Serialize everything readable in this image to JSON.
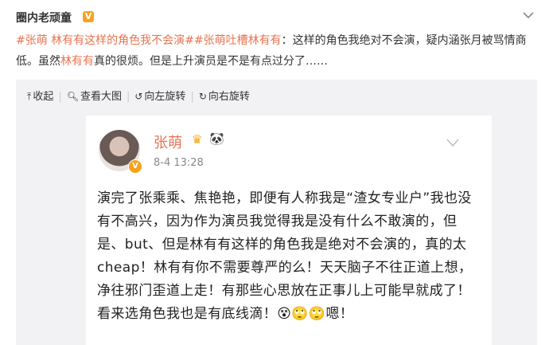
{
  "post": {
    "author": "圈内老顽童",
    "verified_badge": "V",
    "menu_icon": "chevron-down-icon",
    "text_parts": {
      "tag1": "#张萌 林有有这样的角色我不会演#",
      "tag2": "#张萌吐槽林有有",
      "colon": "：这样的角色我绝对不会演，疑内涵张月被骂情商低。虽然",
      "name_link": "林有有",
      "rest": "真的很烦。但是上升演员是不是有点过分了……"
    }
  },
  "toolbar": {
    "collapse_label": "收起",
    "view_large_label": "查看大图",
    "rotate_left_label": "向左旋转",
    "rotate_right_label": "向右旋转"
  },
  "embedded": {
    "name": "张萌",
    "time": "8-4 13:28",
    "body": "演完了张乘乘、焦艳艳，即便有人称我是“渣女专业户”我也没有不高兴，因为作为演员我觉得我是没有什么不敢演的，但是、but、但是林有有这样的角色我是绝对不会演的，真的太cheap！林有有你不需要尊严的么！天天脑子不往正道上想，净往邪门歪道上走！有那些心思放在正事儿上可能早就成了！看来选角色我也是有底线滴！😵🙄🙄嗯！"
  },
  "colors": {
    "link": "#eb7350",
    "badge": "#f7a21c",
    "media_bg": "#f2f2f5"
  }
}
